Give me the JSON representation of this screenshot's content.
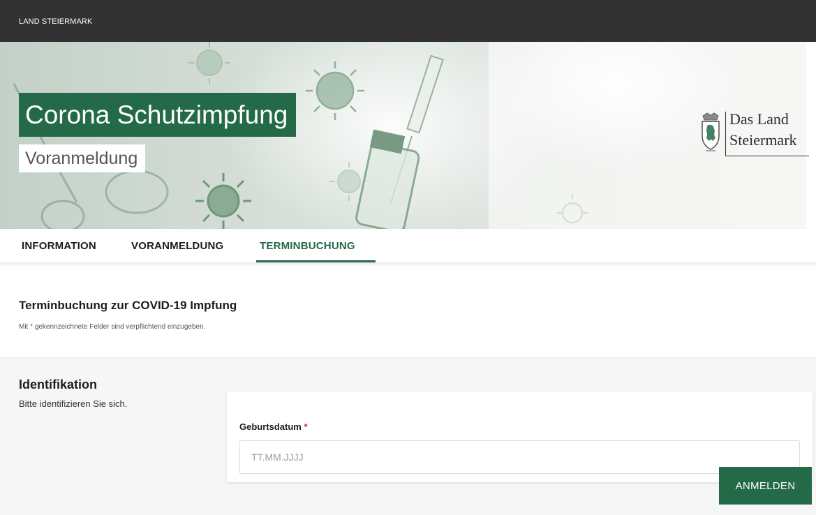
{
  "topbar": {
    "title": "LAND STEIERMARK"
  },
  "hero": {
    "title": "Corona Schutzimpfung",
    "subtitle": "Voranmeldung",
    "brand_line1": "Das Land",
    "brand_line2": "Steiermark"
  },
  "nav": {
    "tabs": [
      {
        "label": "INFORMATION"
      },
      {
        "label": "VORANMELDUNG"
      },
      {
        "label": "TERMINBUCHUNG",
        "active": true
      }
    ]
  },
  "main": {
    "heading": "Terminbuchung zur COVID-19 Impfung",
    "note_prefix": "Mit",
    "note_asterisk": "*",
    "note_suffix": "gekennzeichnete Felder sind verpflichtend einzugeben."
  },
  "identification": {
    "title": "Identifikation",
    "description": "Bitte identifizieren Sie sich.",
    "field_label": "Geburtsdatum",
    "required_mark": "*",
    "placeholder": "TT.MM.JJJJ",
    "value": "",
    "submit_label": "ANMELDEN"
  },
  "colors": {
    "topbar": "#323232",
    "primary_green": "#246a48",
    "required": "#c0392b",
    "section_bg": "#f6f6f6"
  },
  "icons": [
    "styrian-coat-of-arms-icon",
    "virus-icon",
    "syringe-icon",
    "vial-icon"
  ]
}
